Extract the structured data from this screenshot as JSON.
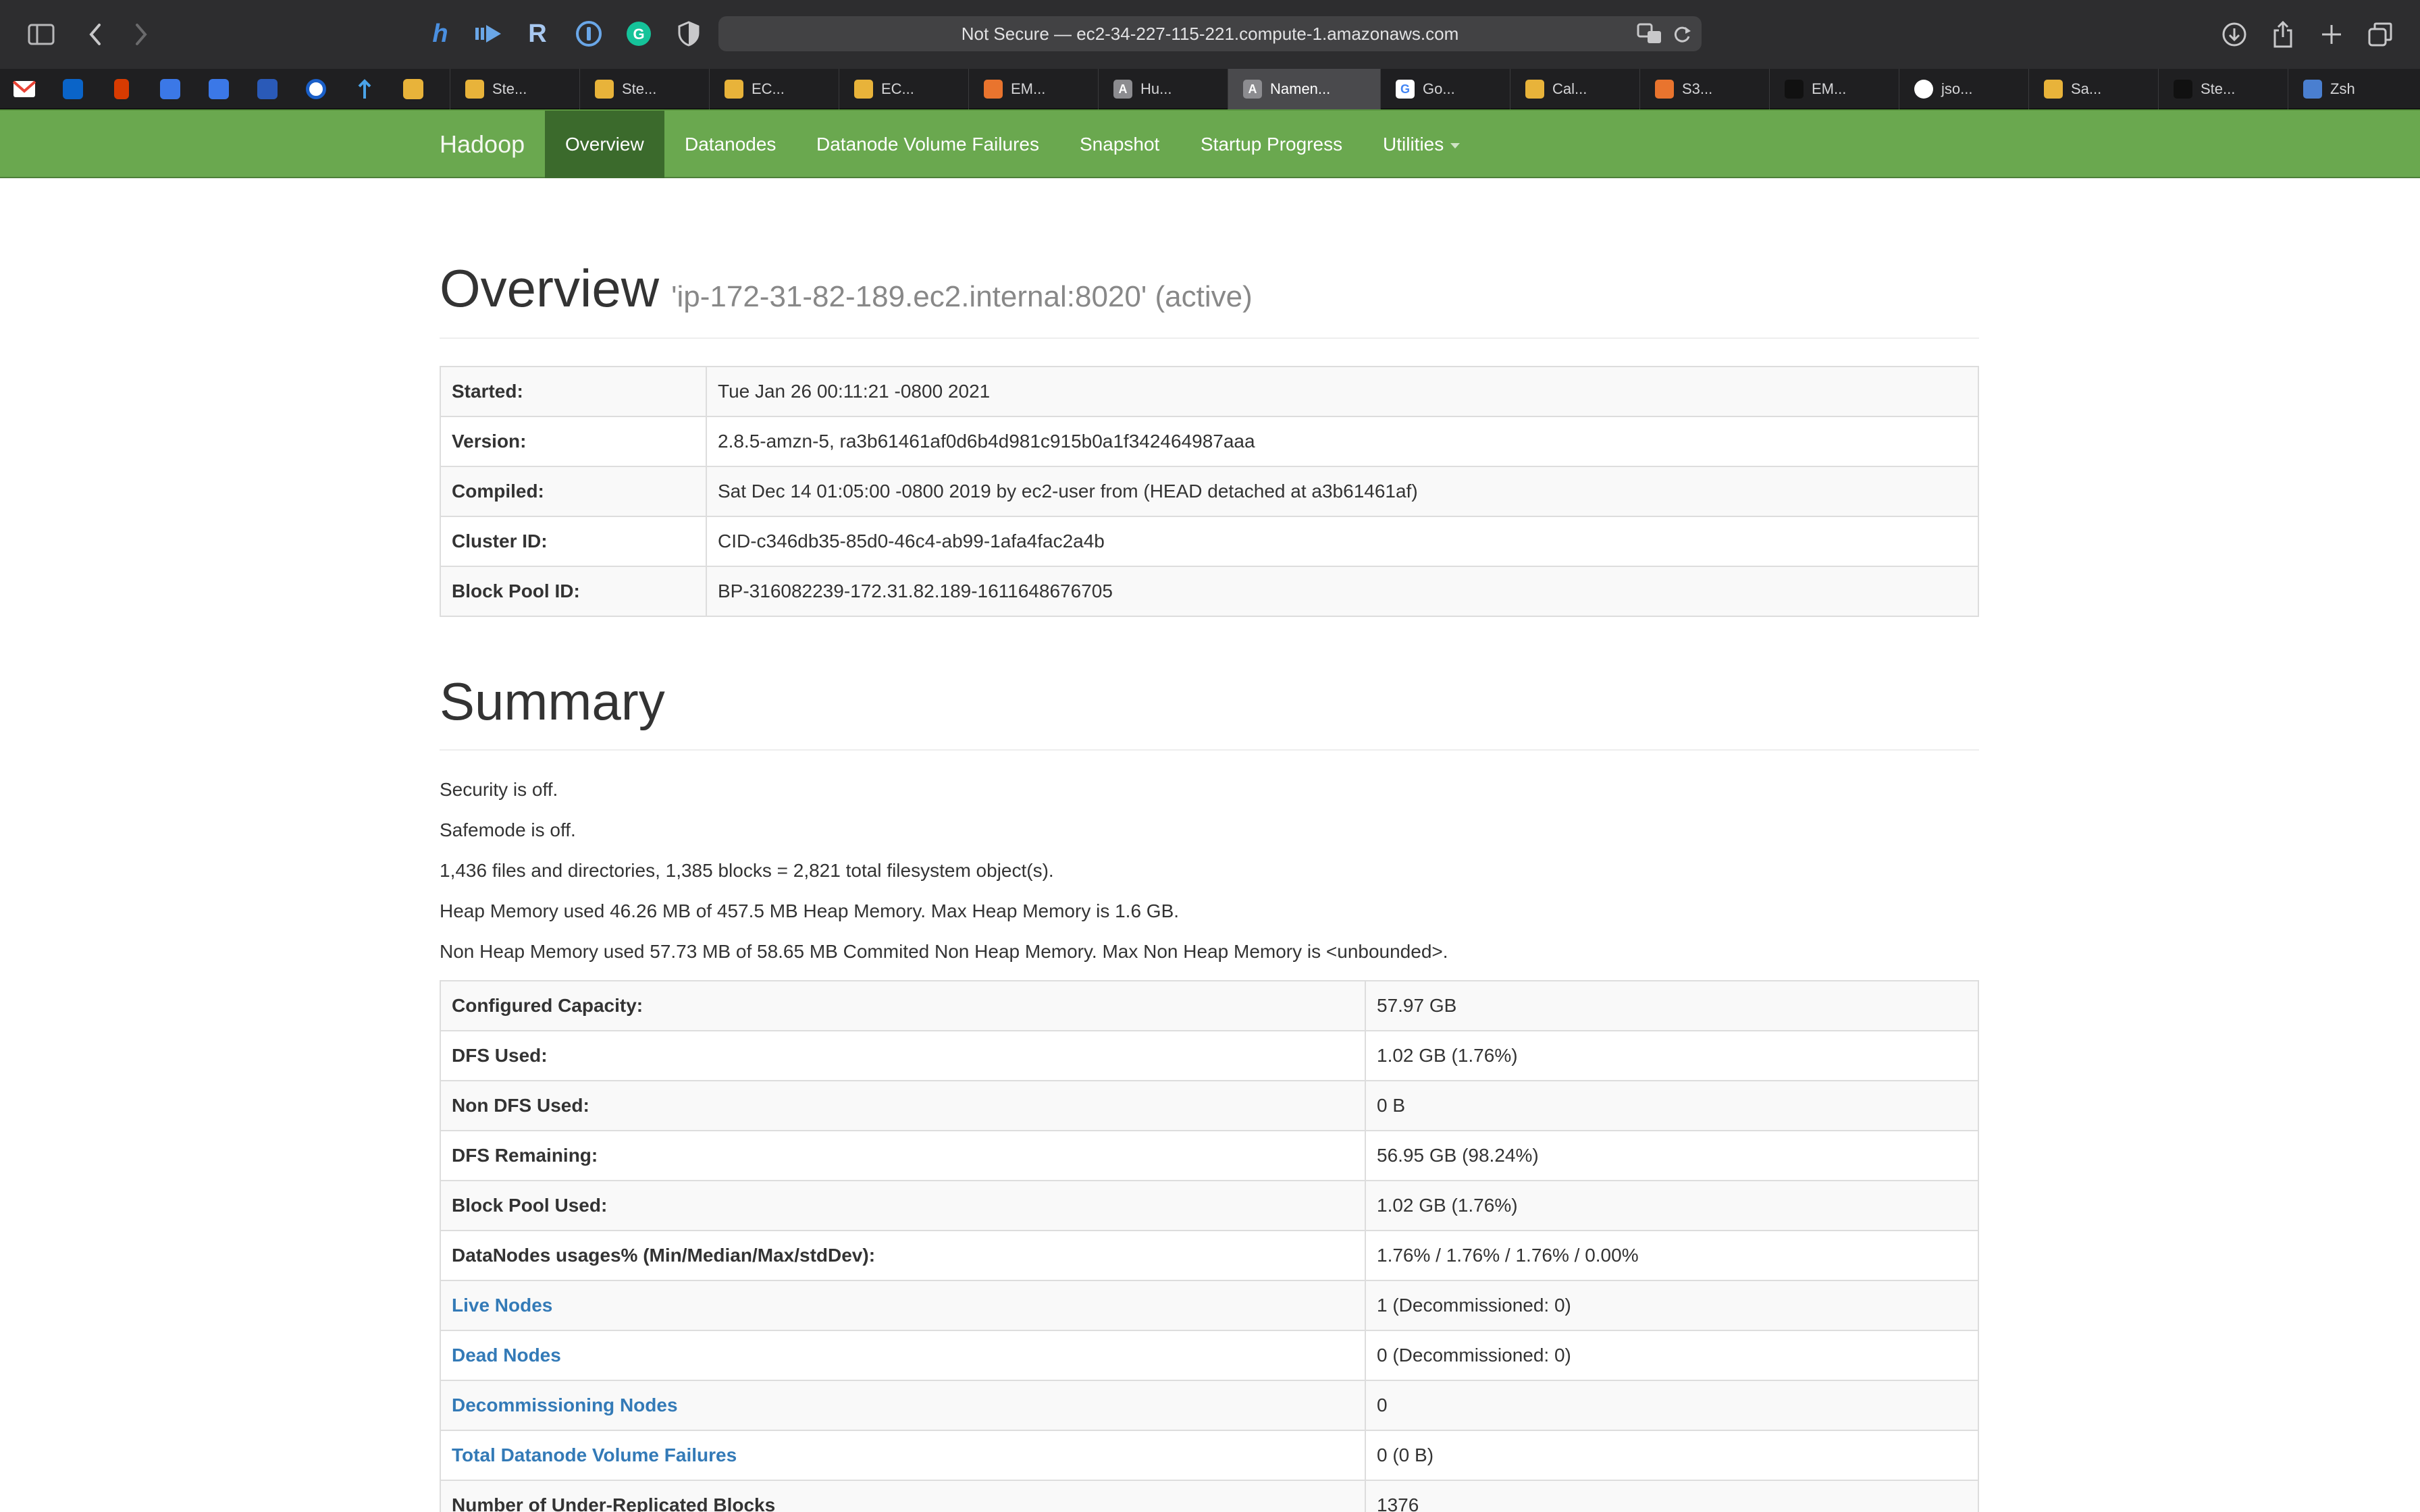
{
  "browser": {
    "url": "Not Secure — ec2-34-227-115-221.compute-1.amazonaws.com",
    "tabs": [
      {
        "label": "Ste...",
        "fav_color": "#e8b33a"
      },
      {
        "label": "Ste...",
        "fav_color": "#e8b33a"
      },
      {
        "label": "EC...",
        "fav_color": "#e8b33a"
      },
      {
        "label": "EC...",
        "fav_color": "#e8b33a"
      },
      {
        "label": "EM...",
        "fav_color": "#e9742e"
      },
      {
        "label": "Hu...",
        "fav_color": "#8c8c90"
      },
      {
        "label": "Namen...",
        "fav_color": "#8c8c90"
      },
      {
        "label": "Go...",
        "fav_color": "#ffffff"
      },
      {
        "label": "Cal...",
        "fav_color": "#e8b33a"
      },
      {
        "label": "S3...",
        "fav_color": "#e9742e"
      },
      {
        "label": "EM...",
        "fav_color": "#111111"
      },
      {
        "label": "jso...",
        "fav_color": "#ffffff"
      },
      {
        "label": "Sa...",
        "fav_color": "#e8b33a"
      },
      {
        "label": "Ste...",
        "fav_color": "#111111"
      },
      {
        "label": "Zsh",
        "fav_color": "#4a7fd0"
      }
    ]
  },
  "nav": {
    "brand": "Hadoop",
    "items": [
      "Overview",
      "Datanodes",
      "Datanode Volume Failures",
      "Snapshot",
      "Startup Progress",
      "Utilities"
    ],
    "accent": "#6aa84f"
  },
  "overview": {
    "title": "Overview",
    "subtitle": "'ip-172-31-82-189.ec2.internal:8020' (active)",
    "rows": [
      {
        "k": "Started:",
        "v": "Tue Jan 26 00:11:21 -0800 2021"
      },
      {
        "k": "Version:",
        "v": "2.8.5-amzn-5, ra3b61461af0d6b4d981c915b0a1f342464987aaa"
      },
      {
        "k": "Compiled:",
        "v": "Sat Dec 14 01:05:00 -0800 2019 by ec2-user from (HEAD detached at a3b61461af)"
      },
      {
        "k": "Cluster ID:",
        "v": "CID-c346db35-85d0-46c4-ab99-1afa4fac2a4b"
      },
      {
        "k": "Block Pool ID:",
        "v": "BP-316082239-172.31.82.189-1611648676705"
      }
    ]
  },
  "summary": {
    "title": "Summary",
    "lines": [
      "Security is off.",
      "Safemode is off.",
      "1,436 files and directories, 1,385 blocks = 2,821 total filesystem object(s).",
      "Heap Memory used 46.26 MB of 457.5 MB Heap Memory. Max Heap Memory is 1.6 GB.",
      "Non Heap Memory used 57.73 MB of 58.65 MB Commited Non Heap Memory. Max Non Heap Memory is <unbounded>."
    ],
    "rows": [
      {
        "k": "Configured Capacity:",
        "v": "57.97 GB"
      },
      {
        "k": "DFS Used:",
        "v": "1.02 GB (1.76%)"
      },
      {
        "k": "Non DFS Used:",
        "v": "0 B"
      },
      {
        "k": "DFS Remaining:",
        "v": "56.95 GB (98.24%)"
      },
      {
        "k": "Block Pool Used:",
        "v": "1.02 GB (1.76%)"
      },
      {
        "k": "DataNodes usages% (Min/Median/Max/stdDev):",
        "v": "1.76% / 1.76% / 1.76% / 0.00%"
      },
      {
        "k": "Live Nodes",
        "v": "1 (Decommissioned: 0)"
      },
      {
        "k": "Dead Nodes",
        "v": "0 (Decommissioned: 0)"
      },
      {
        "k": "Decommissioning Nodes",
        "v": "0"
      },
      {
        "k": "Total Datanode Volume Failures",
        "v": "0 (0 B)"
      },
      {
        "k": "Number of Under-Replicated Blocks",
        "v": "1376"
      }
    ]
  }
}
